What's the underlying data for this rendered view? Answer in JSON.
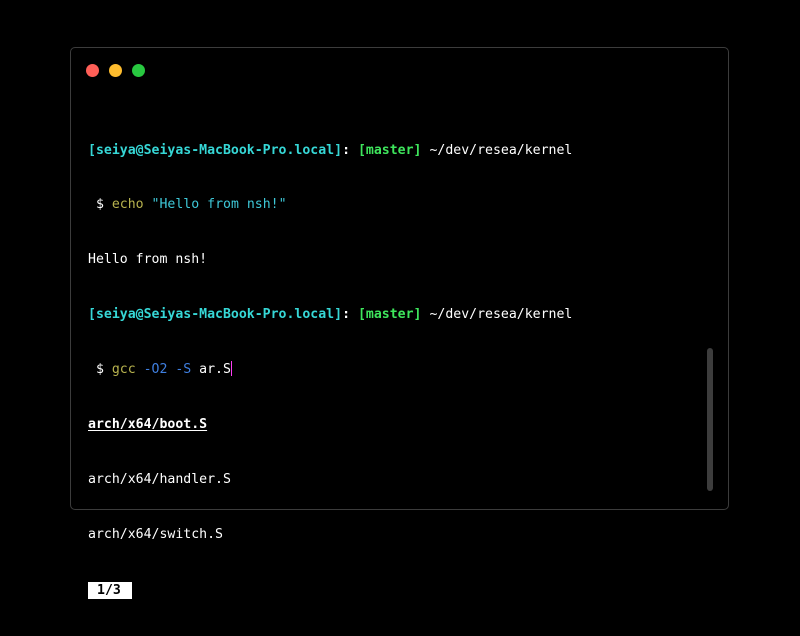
{
  "window": {
    "traffic_lights": {
      "close_color": "#ff5f57",
      "minimize_color": "#febc2e",
      "zoom_color": "#28c840"
    }
  },
  "terminal": {
    "prompt1": {
      "user_host": "[seiya@Seiyas-MacBook-Pro.local]",
      "colon": ":",
      "branch": "[master]",
      "path": " ~/dev/resea/kernel"
    },
    "command1": {
      "prefix": " $ ",
      "cmd": "echo",
      "space": " ",
      "arg": "\"Hello from nsh!\""
    },
    "output1": "Hello from nsh!",
    "prompt2": {
      "user_host": "[seiya@Seiyas-MacBook-Pro.local]",
      "colon": ":",
      "branch": "[master]",
      "path": " ~/dev/resea/kernel"
    },
    "command2": {
      "prefix": " $ ",
      "cmd": "gcc",
      "flags": " -O2 -S",
      "arg": " ar.S"
    },
    "completions": [
      "arch/x64/boot.S",
      "arch/x64/handler.S",
      "arch/x64/switch.S"
    ],
    "pager": "1/3"
  }
}
